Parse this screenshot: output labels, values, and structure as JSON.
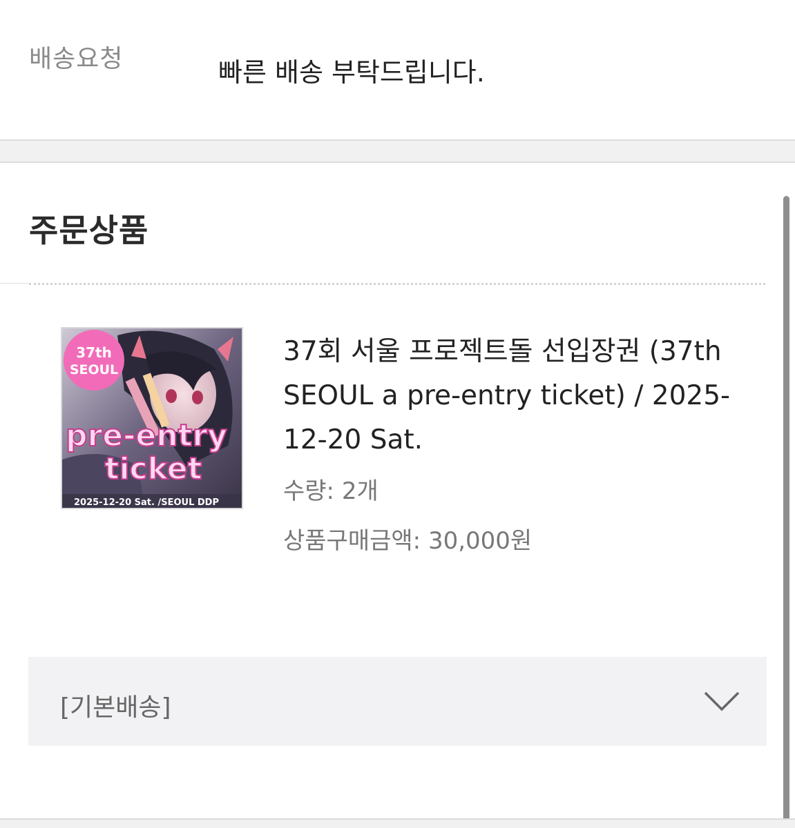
{
  "delivery_request": {
    "label": "배송요청",
    "value": "빠른 배송 부탁드립니다."
  },
  "order_items": {
    "title": "주문상품",
    "item": {
      "name": "37회 서울 프로젝트돌 선입장권 (37th SEOUL a pre-entry ticket) / 2025-12-20 Sat.",
      "quantity": "수량: 2개",
      "price": "상품구매금액: 30,000원",
      "thumbnail": {
        "badge_line1": "37th",
        "badge_line2": "SEOUL",
        "text_line1": "pre-entry",
        "text_line2": "ticket",
        "footer": "2025-12-20 Sat. /SEOUL DDP"
      }
    }
  },
  "shipping": {
    "label": "[기본배송]",
    "expand_icon": "chevron-down-icon"
  },
  "colors": {
    "badge_pink": "#f26bb8",
    "thumb_text": "#ffd8f0",
    "panel_gray": "#f2f2f4",
    "divider_gray": "#f1f1f1"
  }
}
